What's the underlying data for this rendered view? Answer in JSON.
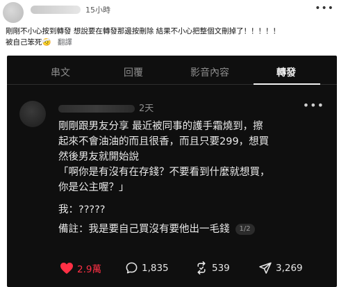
{
  "post": {
    "time": "15小時",
    "more_icon": "more-horizontal-icon",
    "text_line1": "剛剛不小心按到轉發 想說要在轉發那邊按刪除 結果不小心把整個文刪掉了！！！！！",
    "text_line2": "被自己笨死🤕",
    "translate": "翻譯"
  },
  "embedded": {
    "tabs": [
      {
        "label": "串文"
      },
      {
        "label": "回覆"
      },
      {
        "label": "影音內容"
      },
      {
        "label": "轉發",
        "active": true
      }
    ],
    "reply": {
      "time": "2天",
      "lines": [
        "剛剛跟男友分享 最近被同事的護手霜燒到，擦",
        "起來不會油油的而且很香，而且只要299，想買",
        "然後男友就開始說",
        "「啊你是有沒有在存錢？不要看到什麼就想買，",
        "你是公主喔？」",
        "我：?????",
        "備註：我是要自己買沒有要他出一毛錢"
      ],
      "page_badge": "1/2"
    },
    "actions": {
      "likes": "2.9萬",
      "comments": "1,835",
      "reposts": "539",
      "shares": "3,269"
    },
    "colors": {
      "like": "#ff3045",
      "background": "#0f0f0f"
    }
  }
}
